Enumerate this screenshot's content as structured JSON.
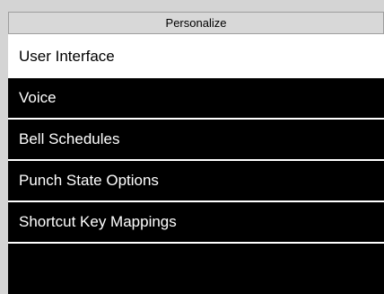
{
  "header": {
    "title": "Personalize"
  },
  "menu": {
    "items": [
      {
        "label": "User Interface",
        "selected": true
      },
      {
        "label": "Voice",
        "selected": false
      },
      {
        "label": "Bell Schedules",
        "selected": false
      },
      {
        "label": "Punch State Options",
        "selected": false
      },
      {
        "label": "Shortcut Key Mappings",
        "selected": false
      }
    ]
  },
  "colors": {
    "background": "#000000",
    "header_bg": "#d8d8d8",
    "selected_bg": "#ffffff",
    "text": "#ffffff",
    "divider": "#ffffff"
  }
}
